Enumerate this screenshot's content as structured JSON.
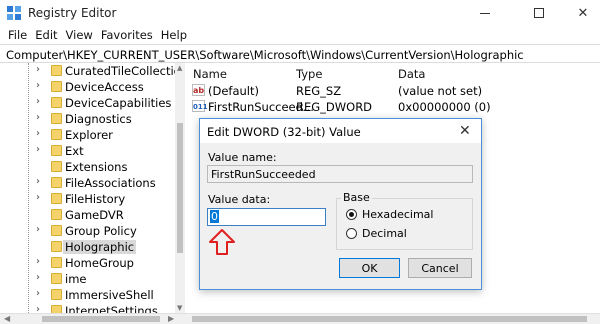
{
  "window": {
    "title": "Registry Editor",
    "controls": {
      "minimize": "",
      "maximize": "",
      "close": "✕"
    }
  },
  "menu": [
    "File",
    "Edit",
    "View",
    "Favorites",
    "Help"
  ],
  "address": "Computer\\HKEY_CURRENT_USER\\Software\\Microsoft\\Windows\\CurrentVersion\\Holographic",
  "tree": {
    "items": [
      {
        "label": "CuratedTileCollections",
        "expandable": true
      },
      {
        "label": "DeviceAccess",
        "expandable": true
      },
      {
        "label": "DeviceCapabilities",
        "expandable": true
      },
      {
        "label": "Diagnostics",
        "expandable": true
      },
      {
        "label": "Explorer",
        "expandable": true
      },
      {
        "label": "Ext",
        "expandable": true
      },
      {
        "label": "Extensions",
        "expandable": false
      },
      {
        "label": "FileAssociations",
        "expandable": true
      },
      {
        "label": "FileHistory",
        "expandable": true
      },
      {
        "label": "GameDVR",
        "expandable": false
      },
      {
        "label": "Group Policy",
        "expandable": true
      },
      {
        "label": "Holographic",
        "expandable": false,
        "selected": true
      },
      {
        "label": "HomeGroup",
        "expandable": true
      },
      {
        "label": "ime",
        "expandable": true
      },
      {
        "label": "ImmersiveShell",
        "expandable": true
      },
      {
        "label": "InternetSettings",
        "expandable": true
      }
    ]
  },
  "list": {
    "columns": [
      "Name",
      "Type",
      "Data"
    ],
    "rows": [
      {
        "icon": "ab",
        "name": "(Default)",
        "type": "REG_SZ",
        "data": "(value not set)"
      },
      {
        "icon": "bin",
        "name": "FirstRunSucceed...",
        "type": "REG_DWORD",
        "data": "0x00000000 (0)"
      }
    ]
  },
  "dialog": {
    "title": "Edit DWORD (32-bit) Value",
    "close": "✕",
    "value_name_label": "Value name:",
    "value_name": "FirstRunSucceeded",
    "value_data_label": "Value data:",
    "value_data": "0",
    "base_label": "Base",
    "base_options": [
      "Hexadecimal",
      "Decimal"
    ],
    "base_selected": "Hexadecimal",
    "ok": "OK",
    "cancel": "Cancel"
  },
  "colors": {
    "accent": "#0078d7",
    "annotation_arrow": "#e02020",
    "folder": "#f5d36b"
  }
}
